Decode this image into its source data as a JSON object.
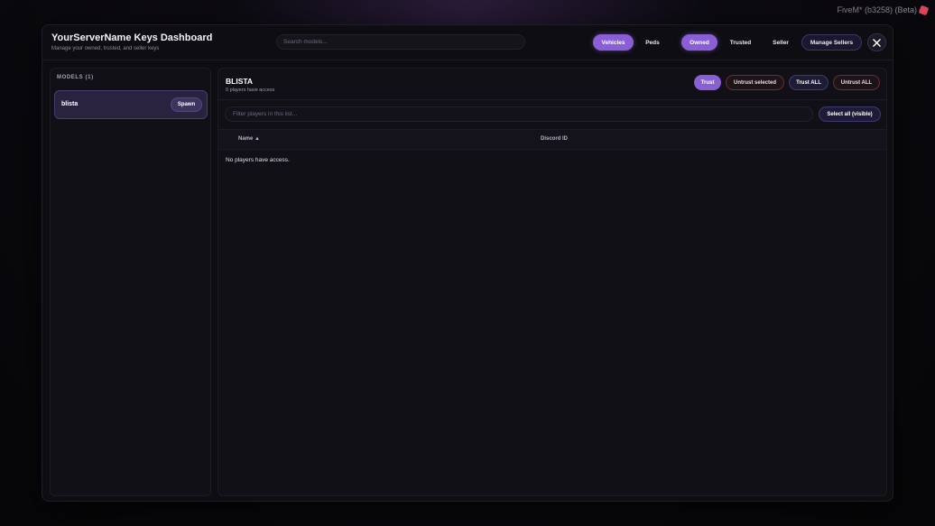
{
  "watermark": {
    "text": "FiveM* (b3258) (Beta)",
    "icon": "fivem-logo-icon"
  },
  "header": {
    "title": "YourServerName Keys Dashboard",
    "subtitle": "Manage your owned, trusted, and seller keys",
    "search_placeholder": "Search models...",
    "category_tabs": [
      {
        "label": "Vehicles",
        "active": true
      },
      {
        "label": "Peds",
        "active": false
      }
    ],
    "key_tabs": [
      {
        "label": "Owned",
        "active": true
      },
      {
        "label": "Trusted",
        "active": false
      },
      {
        "label": "Seller",
        "active": false
      }
    ],
    "manage_sellers_label": "Manage Sellers",
    "close_icon": "close-icon"
  },
  "sidebar": {
    "heading": "MODELS (1)",
    "models": [
      {
        "name": "blista",
        "spawn_label": "Spawn",
        "selected": true
      }
    ]
  },
  "main": {
    "model_title": "BLISTA",
    "access_text": "0 players have access",
    "actions": {
      "trust": "Trust",
      "untrust_selected": "Untrust selected",
      "trust_all": "Trust ALL",
      "untrust_all": "Untrust ALL"
    },
    "filter_placeholder": "Filter players in this list...",
    "select_all_label": "Select all (visible)",
    "table": {
      "columns": [
        "Name ▲",
        "Discord ID"
      ],
      "rows": [],
      "empty_message": "No players have access."
    }
  },
  "colors": {
    "accent": "#8a5fd6",
    "panel": "#101016",
    "danger_border": "#6b2b3a"
  }
}
